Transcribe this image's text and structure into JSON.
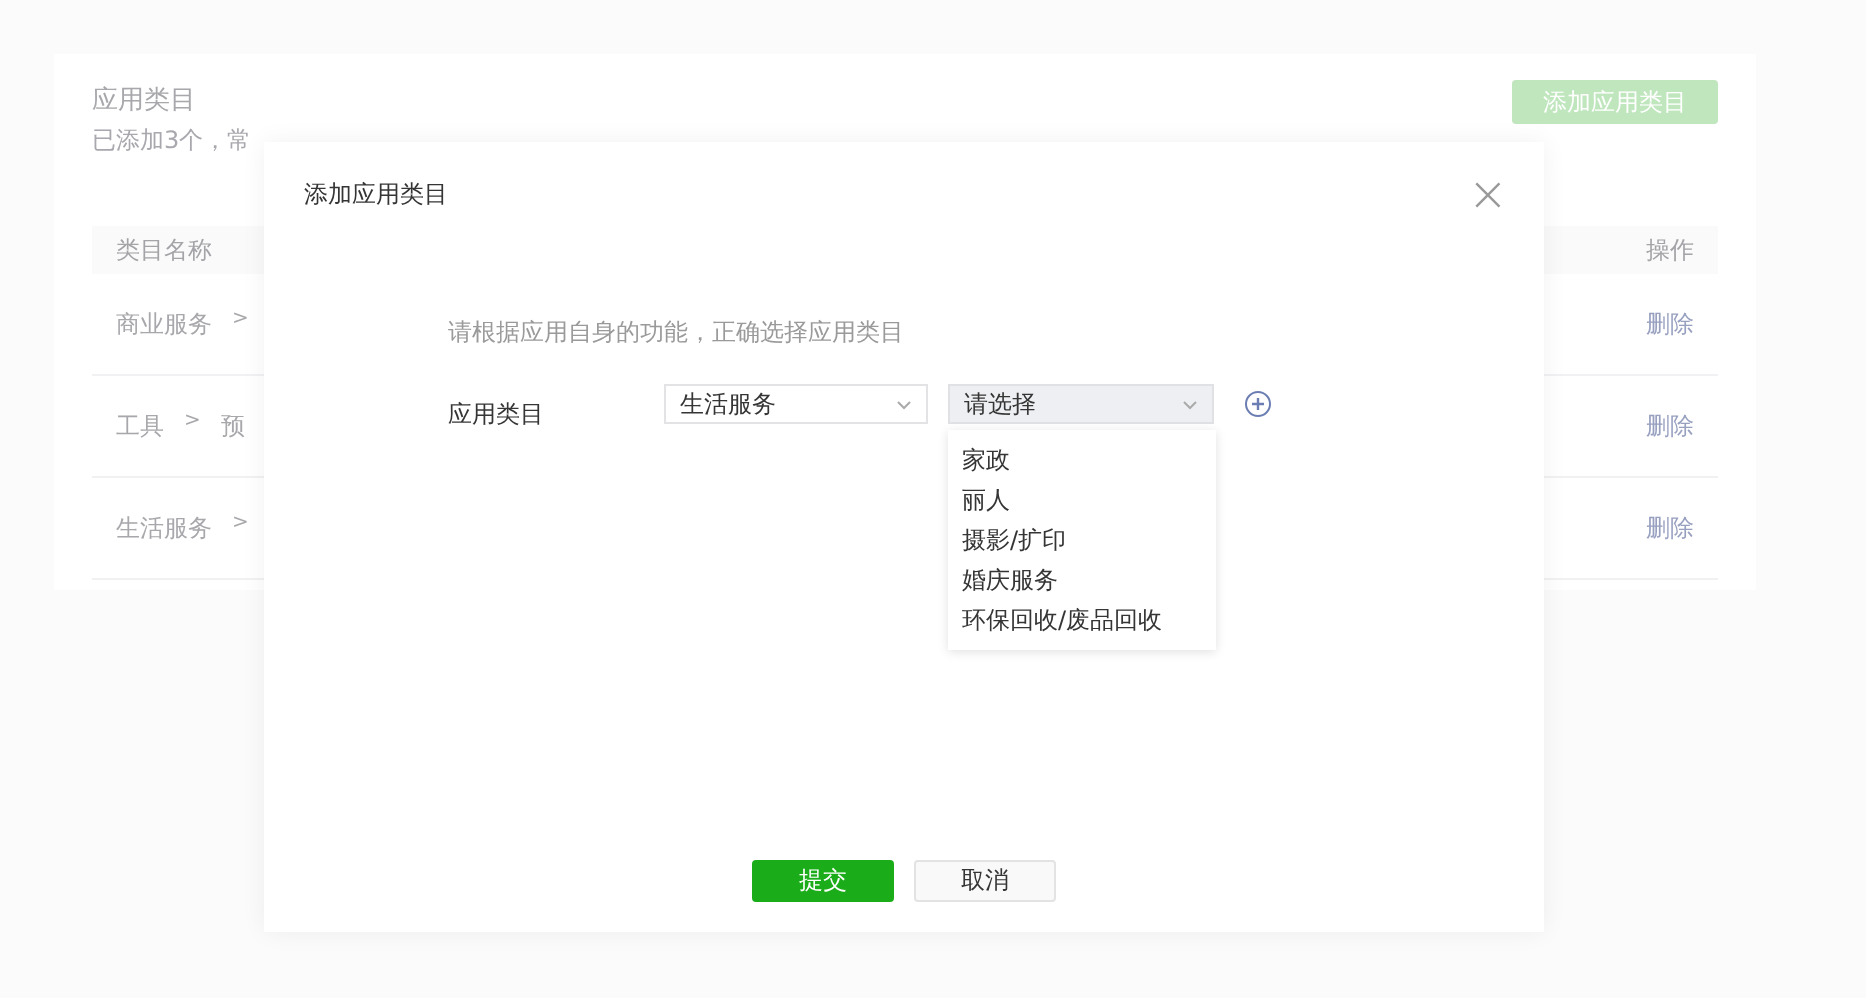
{
  "page": {
    "title": "应用类目",
    "subtitle": "已添加3个，常",
    "add_button": "添加应用类目",
    "table": {
      "columns": [
        "类目名称",
        "操作"
      ],
      "rows": [
        {
          "path": [
            "商业服务",
            ">"
          ],
          "action": "删除"
        },
        {
          "path": [
            "工具",
            ">",
            "预"
          ],
          "action": "删除"
        },
        {
          "path": [
            "生活服务",
            ">"
          ],
          "action": "删除"
        }
      ]
    }
  },
  "dialog": {
    "title": "添加应用类目",
    "close": "×",
    "hint": "请根据应用自身的功能，正确选择应用类目",
    "field_label": "应用类目",
    "select_primary": {
      "value": "生活服务"
    },
    "select_secondary": {
      "placeholder": "请选择",
      "expanded": true,
      "options": [
        "家政",
        "丽人",
        "摄影/扩印",
        "婚庆服务",
        "环保回收/废品回收"
      ]
    },
    "buttons": [
      {
        "label": "提交",
        "kind": "primary"
      },
      {
        "label": "取消",
        "kind": "default"
      }
    ]
  }
}
